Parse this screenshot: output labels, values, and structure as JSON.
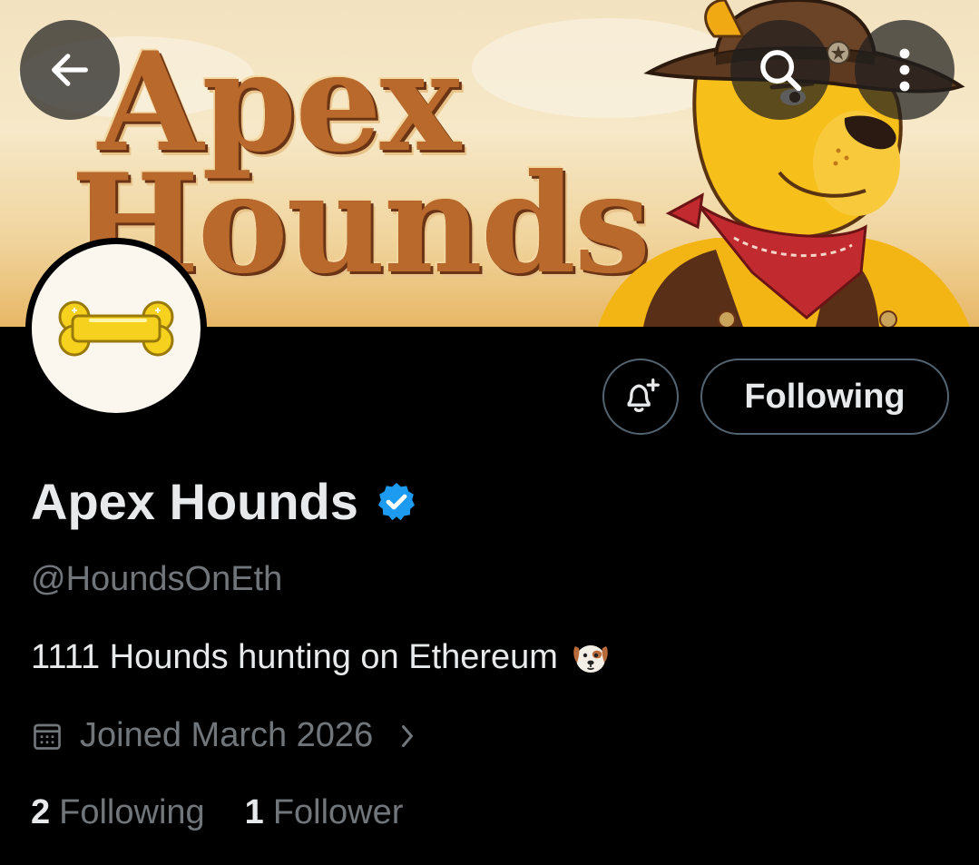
{
  "banner": {
    "line1": "Apex",
    "line2": "Hounds"
  },
  "header": {
    "back_icon": "arrow-left-icon",
    "search_icon": "search-icon",
    "more_icon": "more-vertical-icon"
  },
  "actions": {
    "notify_icon": "bell-plus-icon",
    "follow_label": "Following"
  },
  "profile": {
    "display_name": "Apex Hounds",
    "verified_icon": "verified-badge-icon",
    "verified_color": "#1d9bf0",
    "handle": "@HoundsOnEth",
    "bio": "1111 Hounds hunting on Ethereum",
    "bio_emoji": "dog-face-icon",
    "joined_icon": "calendar-icon",
    "joined": "Joined March 2026",
    "following_count": "2",
    "following_label": "Following",
    "followers_count": "1",
    "followers_label": "Follower"
  },
  "colors": {
    "background": "#000000",
    "text": "#e7e9ea",
    "muted": "#71767b",
    "border": "#536471"
  }
}
